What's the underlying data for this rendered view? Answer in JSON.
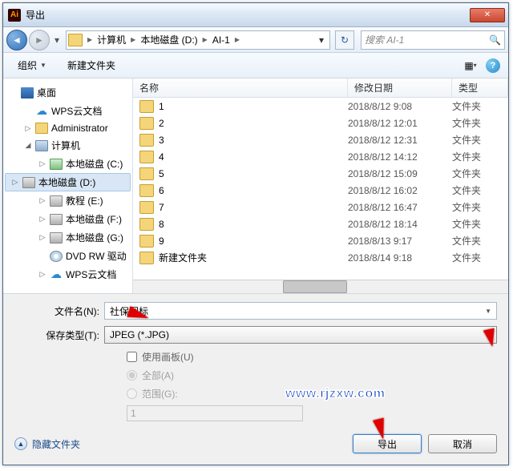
{
  "window": {
    "title": "导出"
  },
  "nav": {
    "path": [
      "计算机",
      "本地磁盘 (D:)",
      "AI-1"
    ],
    "search_placeholder": "搜索 AI-1"
  },
  "toolbar": {
    "organize": "组织",
    "new_folder": "新建文件夹"
  },
  "sidebar": {
    "items": [
      {
        "label": "桌面",
        "icon": "desktop",
        "indent": 0,
        "exp": ""
      },
      {
        "label": "WPS云文档",
        "icon": "cloud",
        "indent": 1,
        "exp": ""
      },
      {
        "label": "Administrator",
        "icon": "folder-y",
        "indent": 1,
        "exp": "▷"
      },
      {
        "label": "计算机",
        "icon": "computer",
        "indent": 1,
        "exp": "◢"
      },
      {
        "label": "本地磁盘 (C:)",
        "icon": "drive-c",
        "indent": 2,
        "exp": "▷"
      },
      {
        "label": "本地磁盘 (D:)",
        "icon": "drive",
        "indent": 2,
        "exp": "▷",
        "selected": true
      },
      {
        "label": "教程 (E:)",
        "icon": "drive",
        "indent": 2,
        "exp": "▷"
      },
      {
        "label": "本地磁盘 (F:)",
        "icon": "drive",
        "indent": 2,
        "exp": "▷"
      },
      {
        "label": "本地磁盘 (G:)",
        "icon": "drive",
        "indent": 2,
        "exp": "▷"
      },
      {
        "label": "DVD RW 驱动",
        "icon": "dvd",
        "indent": 2,
        "exp": ""
      },
      {
        "label": "WPS云文档",
        "icon": "cloud",
        "indent": 2,
        "exp": "▷"
      }
    ]
  },
  "columns": {
    "name": "名称",
    "date": "修改日期",
    "type": "类型"
  },
  "files": [
    {
      "name": "1",
      "date": "2018/8/12 9:08",
      "type": "文件夹"
    },
    {
      "name": "2",
      "date": "2018/8/12 12:01",
      "type": "文件夹"
    },
    {
      "name": "3",
      "date": "2018/8/12 12:31",
      "type": "文件夹"
    },
    {
      "name": "4",
      "date": "2018/8/12 14:12",
      "type": "文件夹"
    },
    {
      "name": "5",
      "date": "2018/8/12 15:09",
      "type": "文件夹"
    },
    {
      "name": "6",
      "date": "2018/8/12 16:02",
      "type": "文件夹"
    },
    {
      "name": "7",
      "date": "2018/8/12 16:47",
      "type": "文件夹"
    },
    {
      "name": "8",
      "date": "2018/8/12 18:14",
      "type": "文件夹"
    },
    {
      "name": "9",
      "date": "2018/8/13 9:17",
      "type": "文件夹"
    },
    {
      "name": "新建文件夹",
      "date": "2018/8/14 9:18",
      "type": "文件夹"
    }
  ],
  "form": {
    "filename_label": "文件名(N):",
    "filename_value": "社保图标",
    "savetype_label": "保存类型(T):",
    "savetype_value": "JPEG (*.JPG)",
    "use_artboard": "使用画板(U)",
    "all": "全部(A)",
    "range": "范围(G):",
    "range_value": "1"
  },
  "footer": {
    "hide_folders": "隐藏文件夹",
    "export": "导出",
    "cancel": "取消"
  },
  "watermark": "www.rjzxw.com"
}
